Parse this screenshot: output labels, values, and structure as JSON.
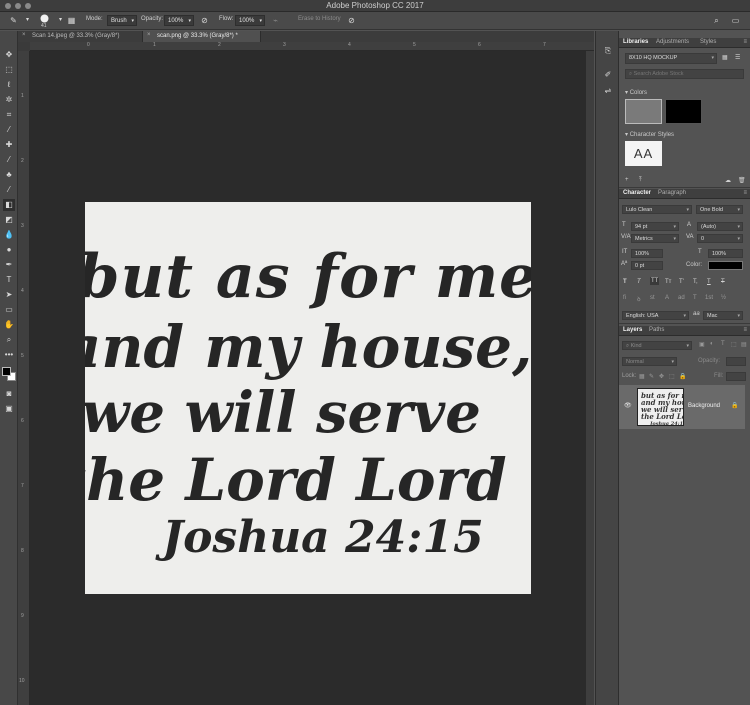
{
  "window": {
    "title": "Adobe Photoshop CC 2017"
  },
  "options_bar": {
    "brush_size": "41",
    "mode_label": "Mode:",
    "mode_value": "Brush",
    "opacity_label": "Opacity:",
    "opacity_value": "100%",
    "flow_label": "Flow:",
    "flow_value": "100%",
    "history_label": "Erase to History"
  },
  "doc_tabs": [
    {
      "label": "Scan 14.jpeg @ 33.3% (Gray/8*)",
      "active": false
    },
    {
      "label": "scan.png @ 33.3% (Gray/8*) *",
      "active": true
    }
  ],
  "rulers": {
    "top": [
      "0",
      "1",
      "2",
      "3",
      "4",
      "5",
      "6",
      "7",
      "8",
      "9"
    ],
    "left": [
      "1",
      "2",
      "3",
      "4",
      "5",
      "6",
      "7",
      "8",
      "9",
      "10"
    ]
  },
  "artwork_text": [
    "but as for me",
    "and my house,",
    "we will serve",
    "the Lord Lord",
    "Joshua 24:15"
  ],
  "panels": {
    "libraries_tabs": [
      "Libraries",
      "Adjustments",
      "Styles"
    ],
    "library_name": "8X10 HQ MOCKUP",
    "library_search_placeholder": "Search Adobe Stock",
    "colors_label": "Colors",
    "swatch_colors": [
      "#7a7a7a",
      "#000000"
    ],
    "character_styles_label": "Character Styles",
    "character_style_sample": "AA",
    "character_tabs": [
      "Character",
      "Paragraph"
    ],
    "font_family": "Lulo Clean",
    "font_style": "One Bold",
    "font_size": "94 pt",
    "leading": "(Auto)",
    "kerning": "Metrics",
    "tracking": "0",
    "vertical_scale": "100%",
    "horizontal_scale": "100%",
    "baseline_shift": "0 pt",
    "color_label": "Color:",
    "type_buttons": [
      "T",
      "T",
      "TT",
      "Tт",
      "T'",
      "T,",
      "T",
      "T"
    ],
    "opentype_buttons": [
      "fi",
      "ꝺ",
      "st",
      "A",
      "ad",
      "T",
      "1st",
      "½"
    ],
    "language": "English: USA",
    "antialias": "Mac",
    "antialias_prefix": "aa",
    "layers_tabs": [
      "Layers",
      "Paths"
    ],
    "layer_filter": "Kind",
    "blend_mode": "Normal",
    "opacity_label": "Opacity:",
    "lock_label": "Lock:",
    "fill_label": "Fill:",
    "layer_name": "Background"
  }
}
